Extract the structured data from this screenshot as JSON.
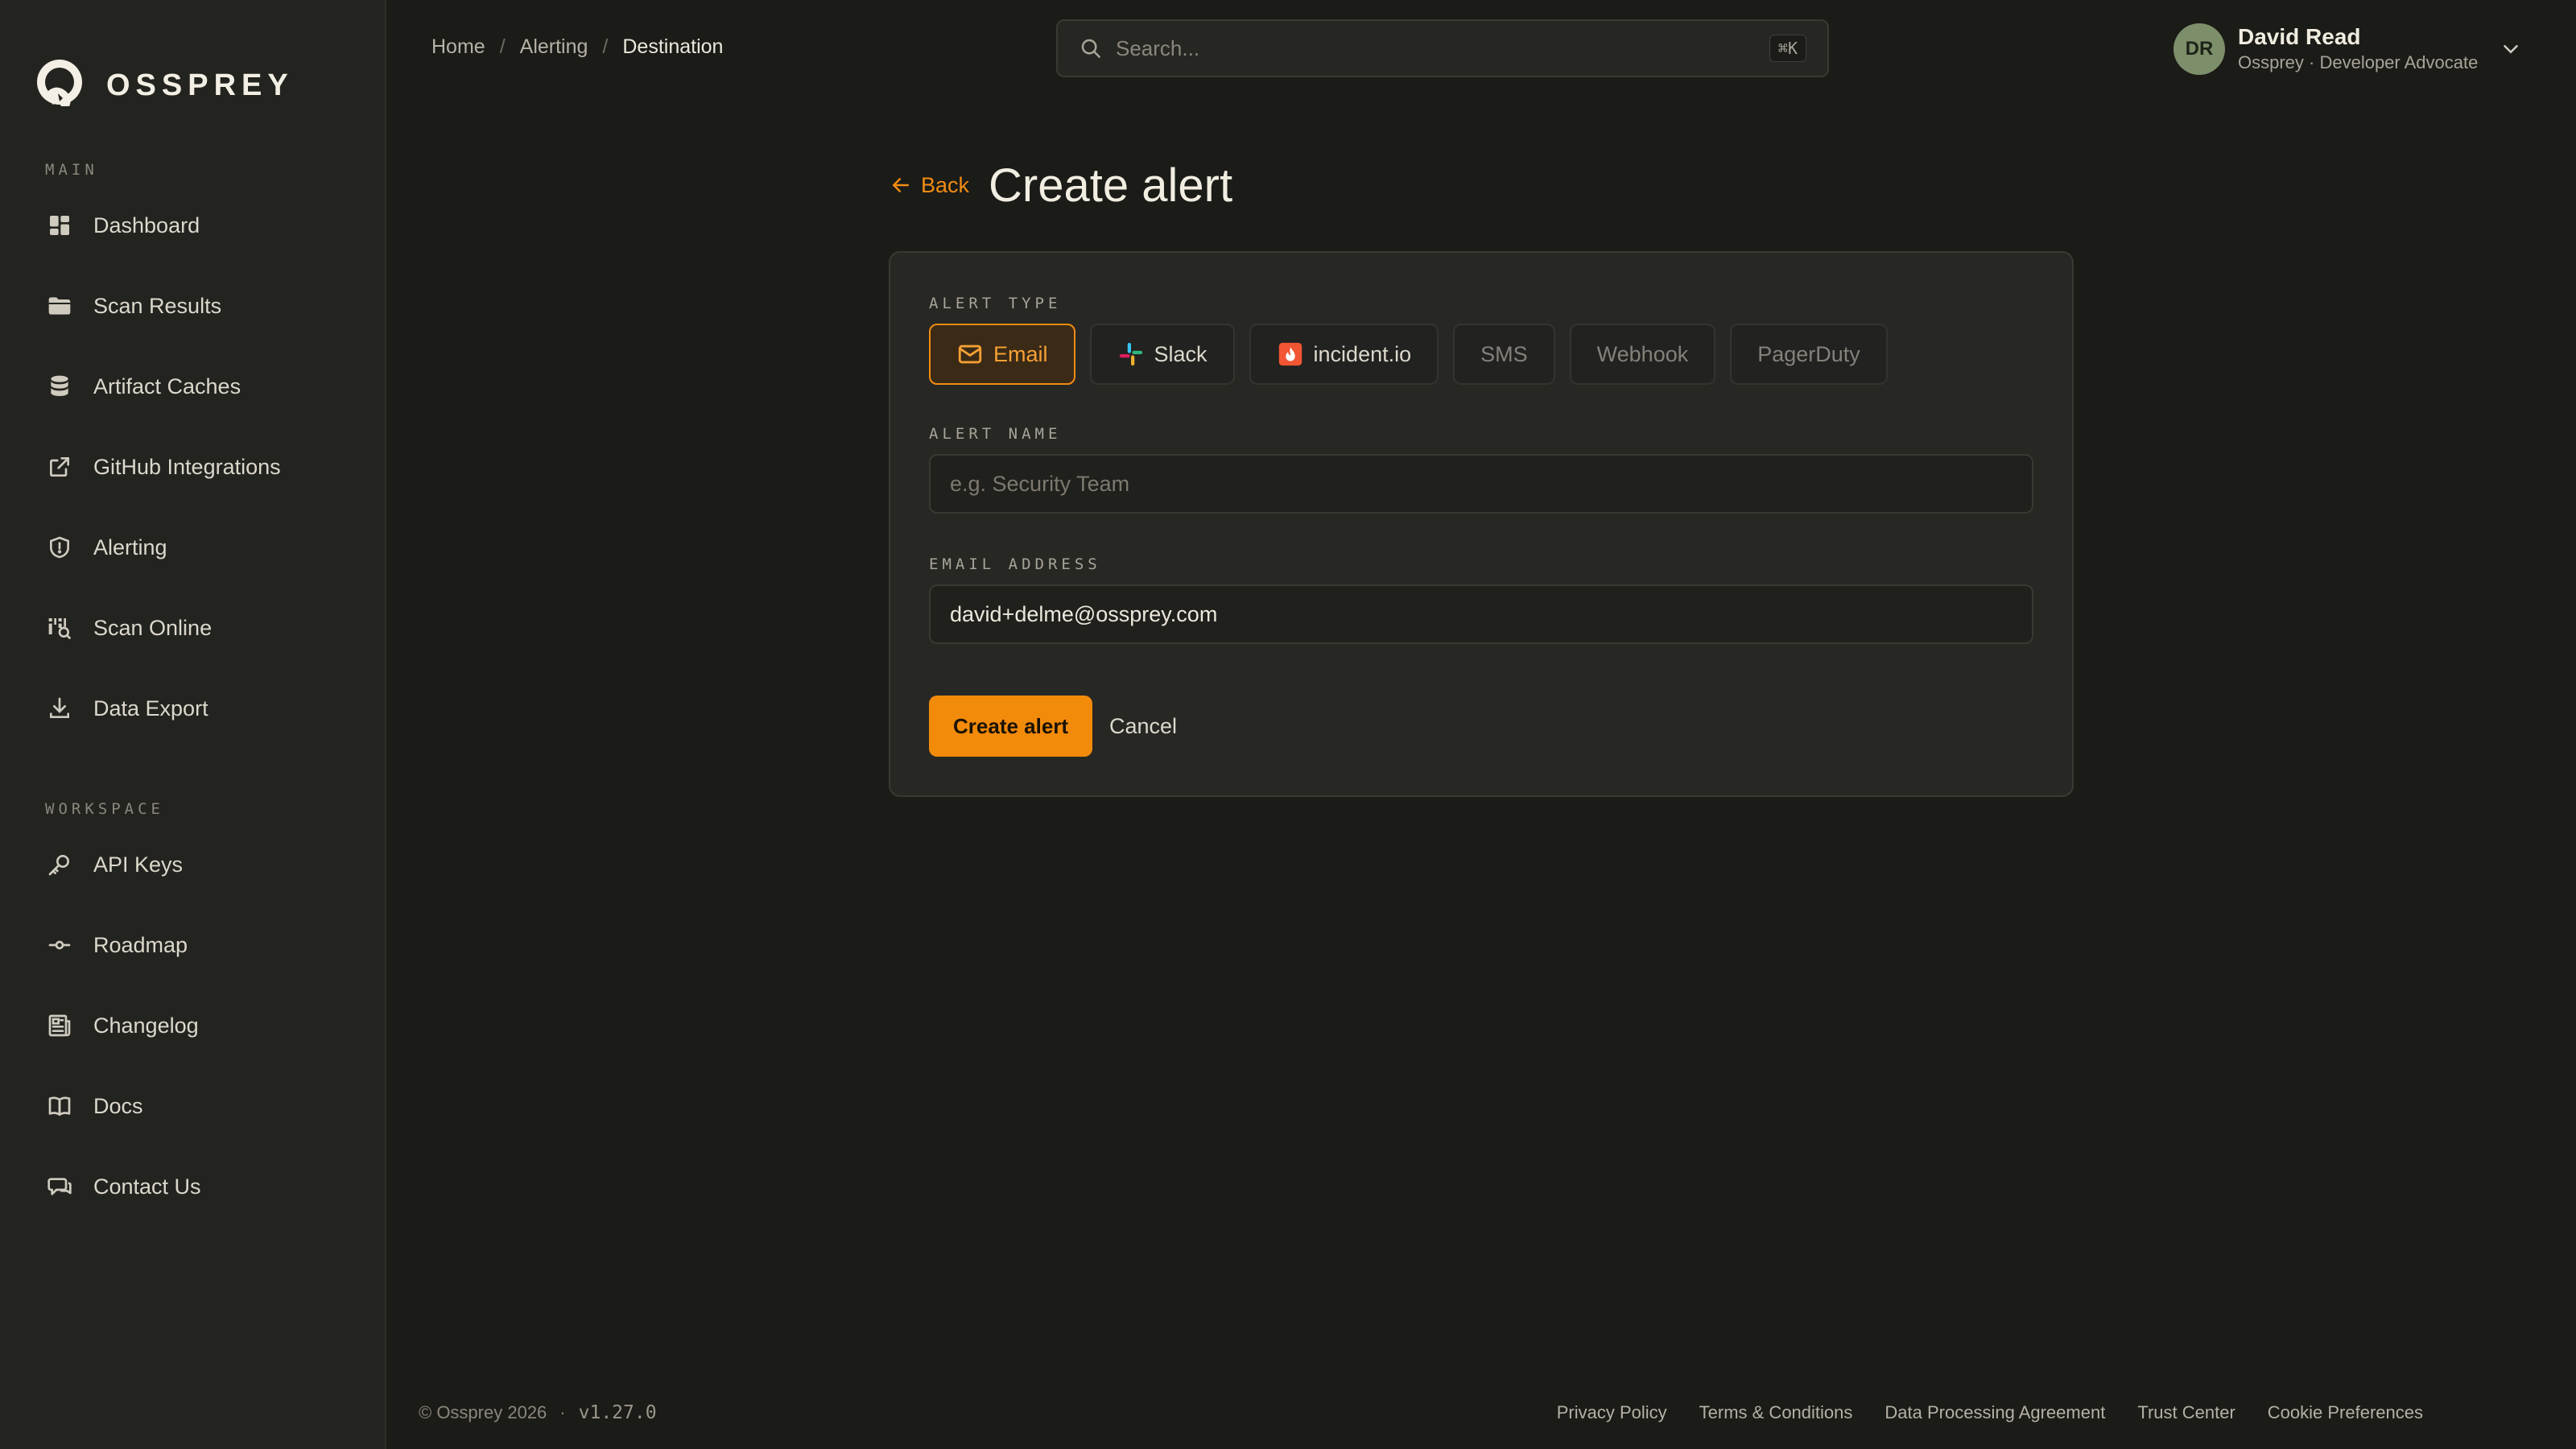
{
  "app": {
    "brand": "OSSPREY"
  },
  "sidebar": {
    "main_label": "MAIN",
    "main_items": [
      {
        "label": "Dashboard",
        "icon": "dashboard-icon"
      },
      {
        "label": "Scan Results",
        "icon": "folder-icon"
      },
      {
        "label": "Artifact Caches",
        "icon": "database-icon"
      },
      {
        "label": "GitHub Integrations",
        "icon": "external-link-icon"
      },
      {
        "label": "Alerting",
        "icon": "shield-icon"
      },
      {
        "label": "Scan Online",
        "icon": "scan-icon"
      },
      {
        "label": "Data Export",
        "icon": "download-icon"
      }
    ],
    "workspace_label": "WORKSPACE",
    "workspace_items": [
      {
        "label": "API Keys",
        "icon": "key-icon"
      },
      {
        "label": "Roadmap",
        "icon": "commit-icon"
      },
      {
        "label": "Changelog",
        "icon": "newspaper-icon"
      },
      {
        "label": "Docs",
        "icon": "book-icon"
      },
      {
        "label": "Contact Us",
        "icon": "chat-icon"
      }
    ]
  },
  "header": {
    "breadcrumb": [
      "Home",
      "Alerting",
      "Destination"
    ],
    "search_placeholder": "Search...",
    "search_shortcut": "⌘K",
    "user": {
      "initials": "DR",
      "name": "David Read",
      "subtitle": "Ossprey · Developer Advocate"
    }
  },
  "main": {
    "back_label": "Back",
    "title": "Create alert",
    "form": {
      "type_label": "ALERT TYPE",
      "types": [
        {
          "label": "Email",
          "active": true,
          "enabled": true
        },
        {
          "label": "Slack",
          "active": false,
          "enabled": true
        },
        {
          "label": "incident.io",
          "active": false,
          "enabled": true
        },
        {
          "label": "SMS",
          "active": false,
          "enabled": false
        },
        {
          "label": "Webhook",
          "active": false,
          "enabled": false
        },
        {
          "label": "PagerDuty",
          "active": false,
          "enabled": false
        }
      ],
      "name_label": "ALERT NAME",
      "name_placeholder": "e.g. Security Team",
      "name_value": "",
      "email_label": "EMAIL ADDRESS",
      "email_value": "david+delme@ossprey.com",
      "submit_label": "Create alert",
      "cancel_label": "Cancel"
    }
  },
  "footer": {
    "copyright": "© Ossprey 2026",
    "separator": "·",
    "version": "v1.27.0",
    "links": [
      "Privacy Policy",
      "Terms & Conditions",
      "Data Processing Agreement",
      "Trust Center",
      "Cookie Preferences"
    ]
  },
  "colors": {
    "accent": "#f18c12",
    "background": "#1b1b18",
    "sidebar": "#232320",
    "card": "#272724"
  }
}
